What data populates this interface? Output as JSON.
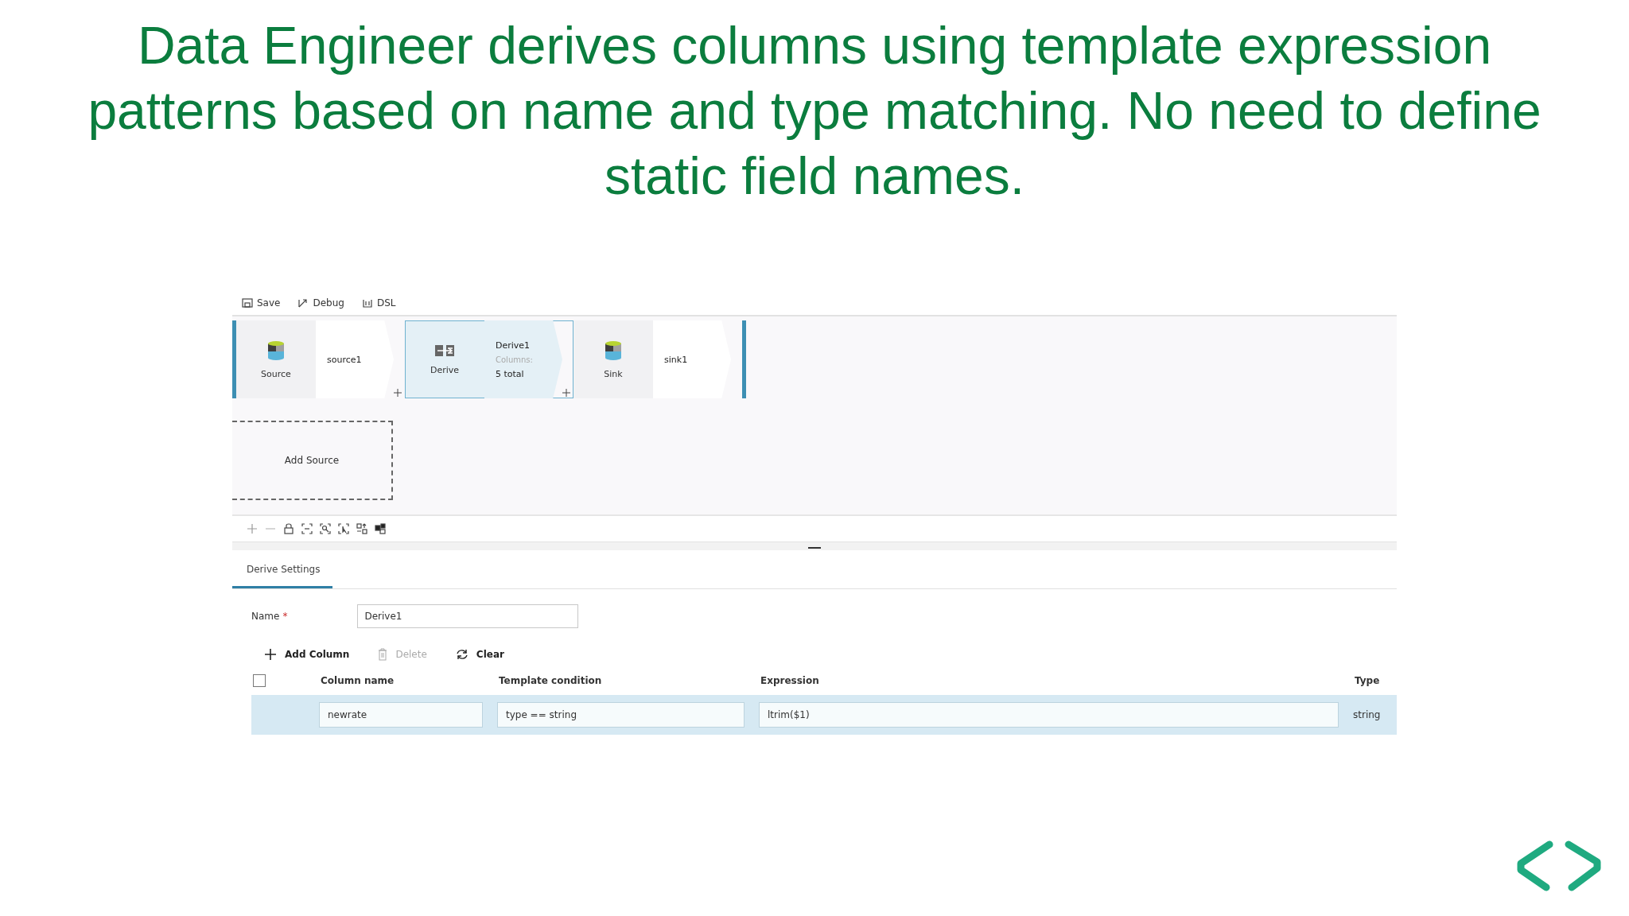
{
  "slide": {
    "title": "Data Engineer derives columns using template expression patterns based on name and type matching. No need to define static field names."
  },
  "toolbar": [
    {
      "kind": "save",
      "label": "Save"
    },
    {
      "kind": "debug",
      "label": "Debug"
    },
    {
      "kind": "dsl",
      "label": "DSL"
    }
  ],
  "pipeline": [
    {
      "kind": "source",
      "type_label": "Source",
      "name": "source1",
      "selected": false
    },
    {
      "kind": "derive",
      "type_label": "Derive",
      "name": "Derive1",
      "selected": true,
      "detail_label": "Columns:",
      "detail_value": "5 total"
    },
    {
      "kind": "sink",
      "type_label": "Sink",
      "name": "sink1",
      "selected": false
    }
  ],
  "add_source": "Add Source",
  "tabs": [
    {
      "label": "Derive Settings",
      "selected": true
    }
  ],
  "name_field": {
    "label": "Name",
    "required_mark": "*",
    "value": "Derive1"
  },
  "actions": [
    {
      "kind": "add",
      "label": "Add Column",
      "disabled": false
    },
    {
      "kind": "delete",
      "label": "Delete",
      "disabled": true
    },
    {
      "kind": "clear",
      "label": "Clear",
      "disabled": false
    }
  ],
  "table": {
    "columns": [
      "Column name",
      "Template condition",
      "Expression",
      "Type"
    ],
    "select_all_checked": false,
    "rows": [
      {
        "selected": true,
        "column_name": "newrate",
        "condition": "type == string",
        "expression": "ltrim($1)",
        "type": "string"
      }
    ]
  }
}
